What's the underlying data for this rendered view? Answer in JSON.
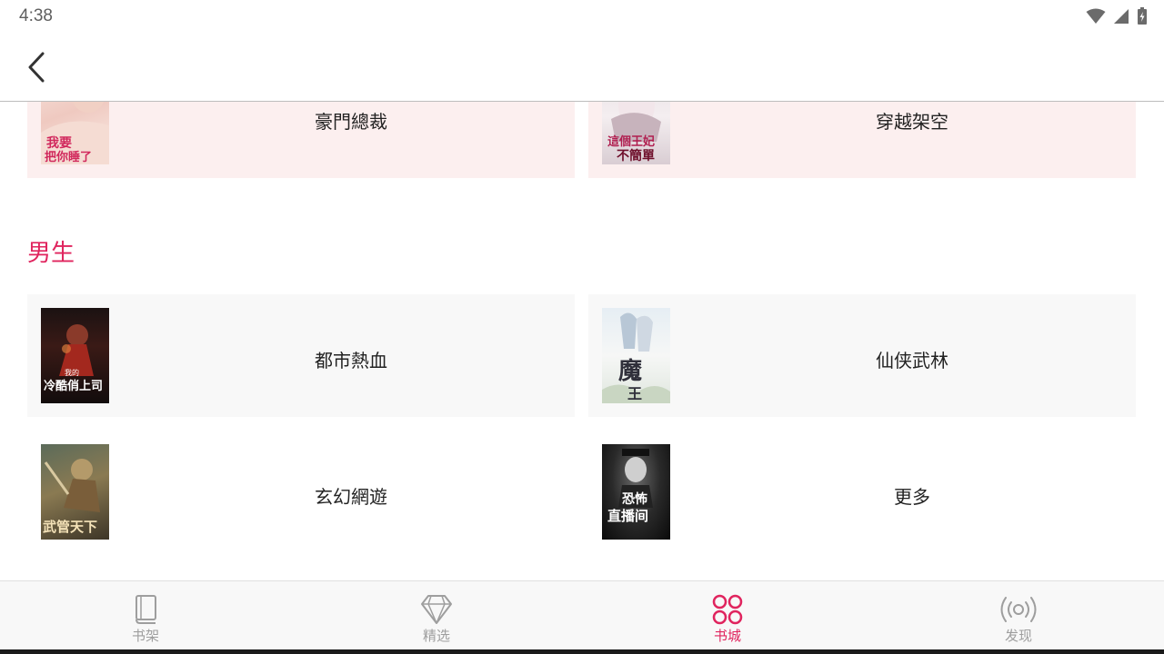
{
  "status_bar": {
    "time": "4:38"
  },
  "header": {
    "back_icon": "chevron-left-icon"
  },
  "categories_top": [
    {
      "label": "豪門總裁",
      "cover_text": "我要把你睡了"
    },
    {
      "label": "穿越架空",
      "cover_text": "這個王妃不簡單"
    }
  ],
  "section": {
    "title": "男生"
  },
  "categories_male": [
    {
      "label": "都市熱血",
      "cover_text": "我的冷酷俏上司"
    },
    {
      "label": "仙侠武林",
      "cover_text": "魔王"
    },
    {
      "label": "玄幻網遊",
      "cover_text": "武管天下"
    },
    {
      "label": "更多",
      "cover_text": "恐怖直播间"
    }
  ],
  "bottom_nav": [
    {
      "label": "书架",
      "icon": "book-icon",
      "active": false
    },
    {
      "label": "精选",
      "icon": "diamond-icon",
      "active": false
    },
    {
      "label": "书城",
      "icon": "grid-circles-icon",
      "active": true
    },
    {
      "label": "发现",
      "icon": "broadcast-icon",
      "active": false
    }
  ],
  "colors": {
    "accent": "#e0245e",
    "inactive": "#9e9e9e",
    "pink_card": "#fcefef",
    "gray_card": "#f8f8f8"
  }
}
